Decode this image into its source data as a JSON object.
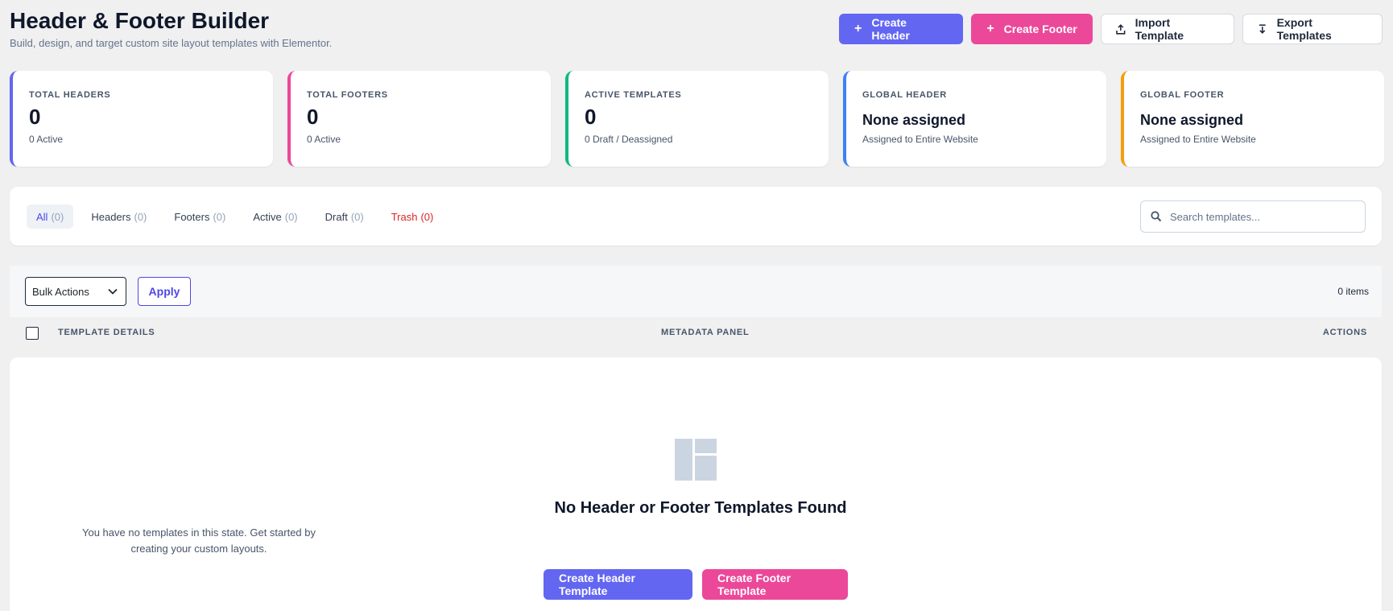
{
  "header": {
    "title": "Header & Footer Builder",
    "subtitle": "Build, design, and target custom site layout templates with Elementor."
  },
  "top_actions": {
    "create_header": "Create Header",
    "create_footer": "Create Footer",
    "import_template": "Import Template",
    "export_templates": "Export Templates"
  },
  "stats": [
    {
      "label": "TOTAL HEADERS",
      "value": "0",
      "sub": "0 Active",
      "color": "#6366f1"
    },
    {
      "label": "TOTAL FOOTERS",
      "value": "0",
      "sub": "0 Active",
      "color": "#ec4899"
    },
    {
      "label": "ACTIVE TEMPLATES",
      "value": "0",
      "sub": "0 Draft / Deassigned",
      "color": "#10b981"
    },
    {
      "label": "GLOBAL HEADER",
      "value": "None assigned",
      "sub": "Assigned to Entire Website",
      "color": "#3b82f6"
    },
    {
      "label": "GLOBAL FOOTER",
      "value": "None assigned",
      "sub": "Assigned to Entire Website",
      "color": "#f59e0b"
    }
  ],
  "filters": [
    {
      "label": "All",
      "count": "(0)"
    },
    {
      "label": "Headers",
      "count": "(0)"
    },
    {
      "label": "Footers",
      "count": "(0)"
    },
    {
      "label": "Active",
      "count": "(0)"
    },
    {
      "label": "Draft",
      "count": "(0)"
    },
    {
      "label": "Trash",
      "count": "(0)"
    }
  ],
  "search": {
    "placeholder": "Search templates..."
  },
  "toolbar": {
    "bulk_actions": "Bulk Actions",
    "apply": "Apply",
    "items": "0 items"
  },
  "table": {
    "col_details": "TEMPLATE DETAILS",
    "col_metadata": "METADATA PANEL",
    "col_actions": "ACTIONS"
  },
  "empty": {
    "title": "No Header or Footer Templates Found",
    "description": "You have no templates in this state. Get started by creating your custom layouts.",
    "create_header": "Create Header Template",
    "create_footer": "Create Footer Template"
  }
}
